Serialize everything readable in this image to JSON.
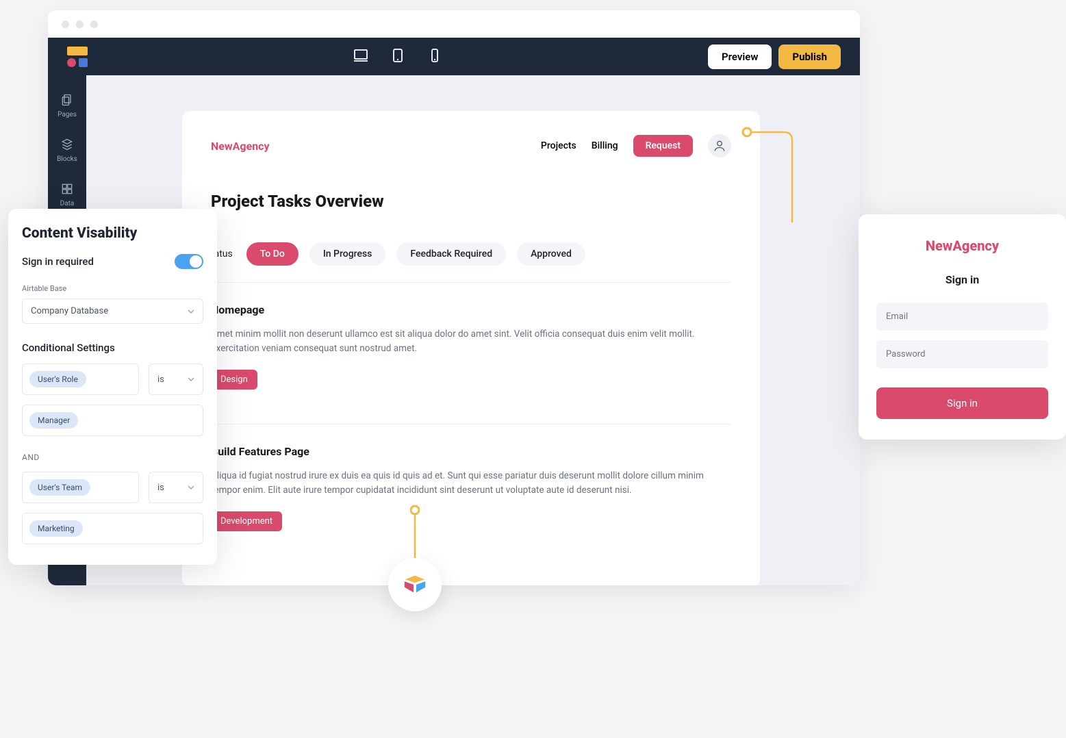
{
  "builder": {
    "preview": "Preview",
    "publish": "Publish"
  },
  "rail": {
    "pages": "Pages",
    "blocks": "Blocks",
    "data": "Data"
  },
  "app": {
    "brand": "NewAgency",
    "nav": {
      "projects": "Projects",
      "billing": "Billing",
      "request": "Request"
    },
    "title": "Project Tasks Overview",
    "status_label": "tatus",
    "tabs": [
      "To Do",
      "In Progress",
      "Feedback Required",
      "Approved"
    ],
    "active_tab": 0,
    "tasks": [
      {
        "title": "Homepage",
        "body": "Amet minim mollit non deserunt ullamco est sit aliqua dolor do amet sint. Velit officia consequat duis enim velit mollit. Exercitation veniam consequat sunt nostrud amet.",
        "tag": "Design"
      },
      {
        "title": "Build Features Page",
        "body": "Aliqua id fugiat nostrud irure ex duis ea quis id quis ad et. Sunt qui esse pariatur duis deserunt mollit dolore cillum minim tempor enim. Elit aute irure tempor cupidatat incididunt sint deserunt ut voluptate aute id deserunt nisi.",
        "tag": "Development"
      }
    ]
  },
  "panel": {
    "title": "Content Visability",
    "signin_required": "Sign in required",
    "base_label": "Airtable Base",
    "base_value": "Company Database",
    "cond_label": "Conditional Settings",
    "op": "is",
    "and": "AND",
    "chips": {
      "role_field": "User's Role",
      "role_value": "Manager",
      "team_field": "User's Team",
      "team_value": "Marketing"
    }
  },
  "signin": {
    "brand": "NewAgency",
    "title": "Sign in",
    "email_ph": "Email",
    "password_ph": "Password",
    "button": "Sign in"
  },
  "colors": {
    "accent": "#d94a6c",
    "amber": "#f4b942",
    "navy": "#1e2a3a"
  }
}
